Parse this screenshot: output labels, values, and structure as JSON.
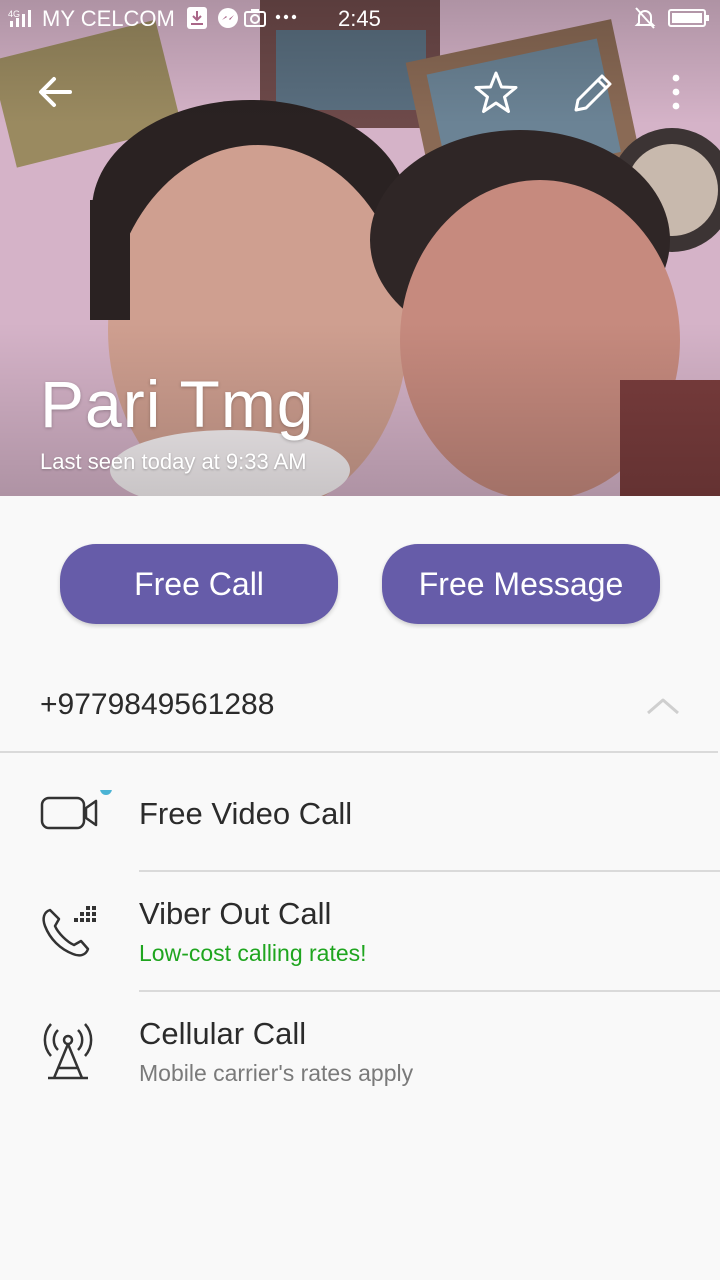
{
  "status_bar": {
    "network": "4G",
    "carrier": "MY CELCOM",
    "time": "2:45",
    "notification_icons": [
      "download-icon",
      "messenger-icon",
      "camera-icon",
      "more-dots-icon"
    ],
    "right_icons": [
      "silent-bell-icon",
      "battery-icon"
    ]
  },
  "top_bar": {
    "icons": [
      "back-arrow-icon",
      "star-icon",
      "pencil-icon",
      "overflow-menu-icon"
    ]
  },
  "contact": {
    "name": "Pari Tmg",
    "last_seen": "Last seen today at 9:33 AM"
  },
  "actions": {
    "free_call": "Free Call",
    "free_message": "Free Message"
  },
  "phone": {
    "number": "+9779849561288",
    "expanded": true
  },
  "call_options": [
    {
      "title": "Free Video Call",
      "subtitle": "",
      "icon": "video-camera-icon",
      "badge_color": "#4bb3d4"
    },
    {
      "title": "Viber Out Call",
      "subtitle": "Low-cost calling rates!",
      "icon": "viber-out-phone-icon",
      "subtitle_color": "#1fa51f"
    },
    {
      "title": "Cellular Call",
      "subtitle": "Mobile carrier's rates apply",
      "icon": "cell-tower-icon",
      "subtitle_color": "#7a7a7a"
    }
  ],
  "colors": {
    "accent": "#665ca9",
    "positive": "#1fa51f",
    "badge": "#4bb3d4"
  }
}
